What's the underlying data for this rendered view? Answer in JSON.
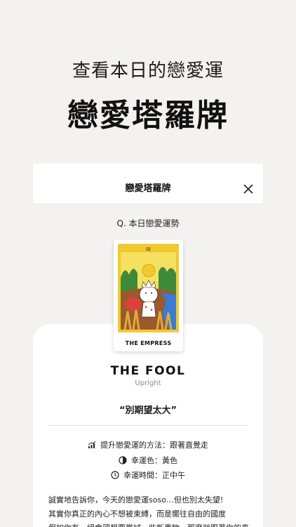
{
  "promo": {
    "subtitle": "查看本日的戀愛運",
    "title": "戀愛塔羅牌"
  },
  "screen": {
    "header_title": "戀愛塔羅牌",
    "close_icon": "close-icon",
    "question": "Q. 本日戀愛運勢",
    "card": {
      "name": "THE EMPRESS",
      "numeral": "III"
    },
    "result": {
      "title": "THE FOOL",
      "orientation": "Upright",
      "quote": "“別期望太大”",
      "tips": [
        {
          "icon": "chart-up-icon",
          "text": "提升戀愛運的方法：跟著直覺走"
        },
        {
          "icon": "half-circle-icon",
          "text": "幸運色：黃色"
        },
        {
          "icon": "clock-icon",
          "text": "幸運時間：正中午"
        }
      ],
      "body_lines": [
        "誠實地告訴你，今天的戀愛運soso…但也別太失望!",
        "其實你真正的內心不想被束縛，而是嚮往自由的國度",
        "假如你有，絕會頭想要嘗試一些新事物，那麼就跟著你的直"
      ]
    }
  },
  "colors": {
    "background": "#f3f2f1",
    "card_frame": "#f1c92e",
    "text": "#1c1c1c"
  }
}
